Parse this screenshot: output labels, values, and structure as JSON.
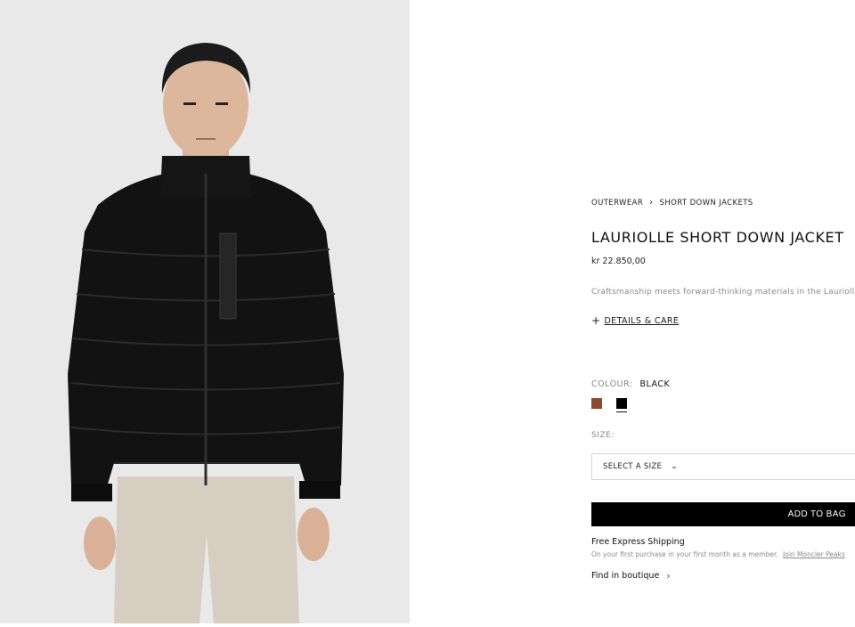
{
  "product_image": {
    "alt_icon": "product-photo"
  },
  "breadcrumb": {
    "items": [
      "OUTERWEAR",
      "SHORT DOWN JACKETS"
    ],
    "separator_icon": "chevron-right-icon"
  },
  "product": {
    "title": "LAURIOLLE SHORT DOWN JACKET",
    "price": "kr 22.850,00",
    "description": "Craftsmanship meets forward-thinking materials in the Lauriolle sh",
    "details_label": "DETAILS & CARE",
    "details_icon": "plus-icon"
  },
  "colour": {
    "label": "COLOUR:",
    "selected": "BLACK",
    "swatches": [
      {
        "name": "brown",
        "hex": "#8b4a32",
        "selected": false
      },
      {
        "name": "black",
        "hex": "#000000",
        "selected": true
      }
    ]
  },
  "size": {
    "label": "SIZE:",
    "select_text": "SELECT A SIZE",
    "chevron_icon": "chevron-down-icon"
  },
  "actions": {
    "add_to_bag": "ADD TO BAG"
  },
  "shipping": {
    "title": "Free Express Shipping",
    "note": "On your first purchase in your first month as a member.",
    "link": "Join Moncler Peaks"
  },
  "boutique": {
    "label": "Find in boutique",
    "chevron_icon": "chevron-right-icon"
  },
  "colors": {
    "photo_background": "#e8e8e8",
    "jacket": "#111111",
    "trousers": "#d6cfc1",
    "skin": "#dcb79c",
    "button": "#000000"
  }
}
